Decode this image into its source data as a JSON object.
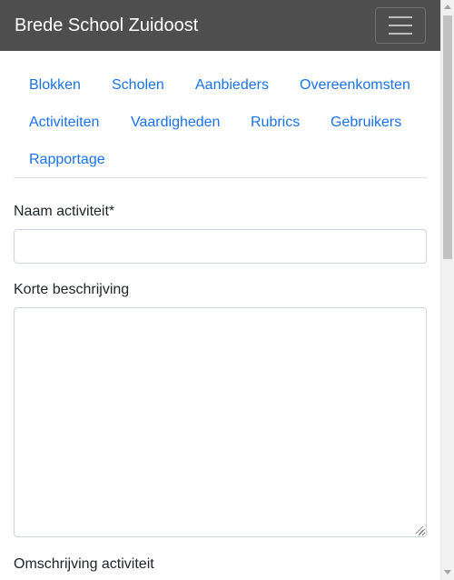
{
  "navbar": {
    "brand": "Brede School Zuidoost",
    "toggler_icon": "hamburger-menu-icon"
  },
  "tabs": [
    {
      "label": "Blokken"
    },
    {
      "label": "Scholen"
    },
    {
      "label": "Aanbieders"
    },
    {
      "label": "Overeenkomsten"
    },
    {
      "label": "Activiteiten"
    },
    {
      "label": "Vaardigheden"
    },
    {
      "label": "Rubrics"
    },
    {
      "label": "Gebruikers"
    },
    {
      "label": "Rapportage"
    }
  ],
  "form": {
    "name_label": "Naam activiteit*",
    "name_value": "",
    "short_desc_label": "Korte beschrijving",
    "short_desc_value": "",
    "description_label": "Omschrijving activiteit"
  },
  "colors": {
    "navbar_bg": "#4e4e4e",
    "link": "#1a73e8"
  }
}
